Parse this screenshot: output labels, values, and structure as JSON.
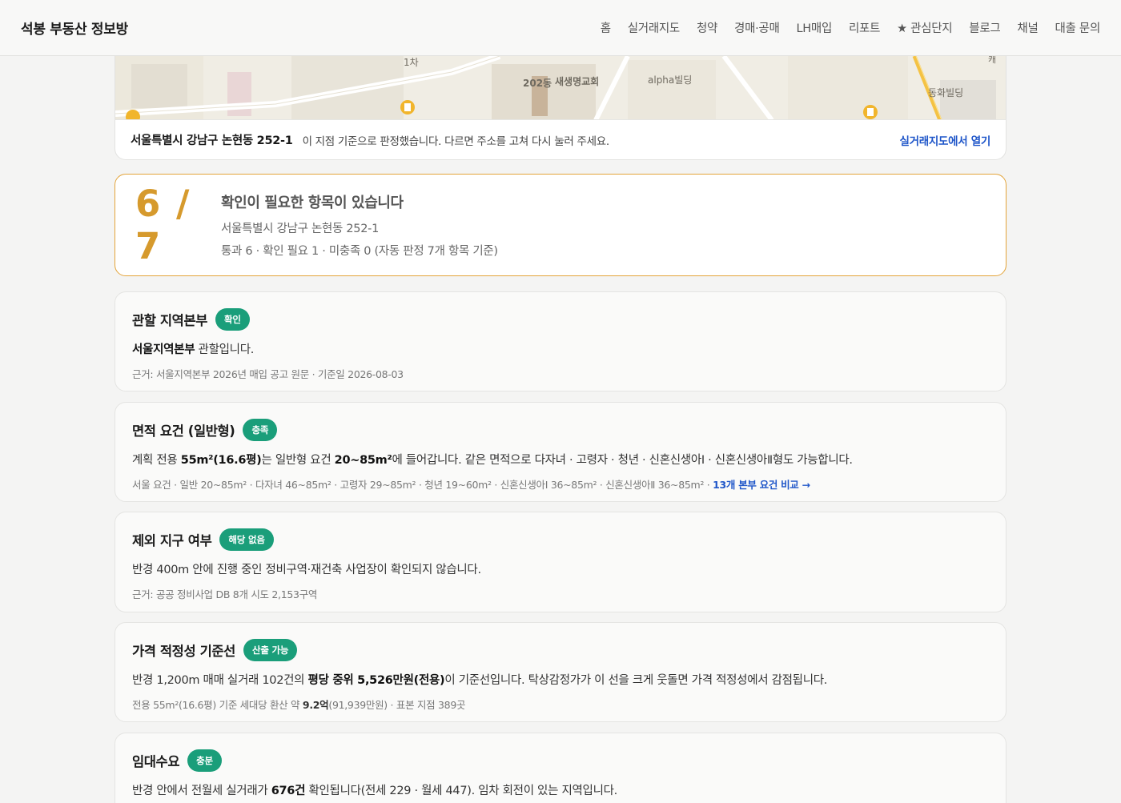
{
  "header": {
    "brand": "석봉 부동산 정보방",
    "nav": [
      "홈",
      "실거래지도",
      "청약",
      "경매·공매",
      "LH매입",
      "리포트",
      "★ 관심단지",
      "블로그",
      "채널",
      "대출 문의"
    ]
  },
  "map": {
    "labels": [
      "1차",
      "202동",
      "새생명교회",
      "alpha빌딩",
      "동화빌딩",
      "캐"
    ]
  },
  "address": {
    "main": "서울특별시 강남구 논현동 252-1",
    "note": "이 지점 기준으로 판정했습니다. 다르면 주소를 고쳐 다시 눌러 주세요.",
    "link": "실거래지도에서 열기"
  },
  "score": {
    "value": "6 / 7",
    "title": "확인이 필요한 항목이 있습니다",
    "address": "서울특별시 강남구 논현동 252-1",
    "summary": "통과 6 · 확인 필요 1 · 미충족 0 (자동 판정 7개 항목 기준)"
  },
  "items": [
    {
      "title": "관할 지역본부",
      "badge": "확인",
      "body_bold": "서울지역본부",
      "body_rest": " 관할입니다.",
      "foot": "근거: 서울지역본부 2026년 매입 공고 원문 · 기준일 2026-08-03"
    },
    {
      "title": "면적 요건 (일반형)",
      "badge": "충족",
      "body_1": "계획 전용 ",
      "body_b1": "55m²(16.6평)",
      "body_2": "는 일반형 요건 ",
      "body_b2": "20~85m²",
      "body_3": "에 들어갑니다. 같은 면적으로 다자녀 · 고령자 · 청년 · 신혼신생아Ⅰ · 신혼신생아Ⅱ형도 가능합니다.",
      "foot": "서울 요건 · 일반 20~85m² · 다자녀 46~85m² · 고령자 29~85m² · 청년 19~60m² · 신혼신생아Ⅰ 36~85m² · 신혼신생아Ⅱ 36~85m² · ",
      "foot_link": "13개 본부 요건 비교 →"
    },
    {
      "title": "제외 지구 여부",
      "badge": "해당 없음",
      "body": "반경 400m 안에 진행 중인 정비구역·재건축 사업장이 확인되지 않습니다.",
      "foot": "근거: 공공 정비사업 DB 8개 시도 2,153구역"
    },
    {
      "title": "가격 적정성 기준선",
      "badge": "산출 가능",
      "body_1": "반경 1,200m 매매 실거래 102건의 ",
      "body_b1": "평당 중위 5,526만원(전용)",
      "body_2": "이 기준선입니다. 탁상감정가가 이 선을 크게 웃돌면 가격 적정성에서 감점됩니다.",
      "foot_1": "전용 55m²(16.6평) 기준 세대당 환산 약 ",
      "foot_b": "9.2억",
      "foot_2": "(91,939만원) · 표본 지점 389곳"
    },
    {
      "title": "임대수요",
      "badge": "충분",
      "body_1": "반경 안에서 전월세 실거래가 ",
      "body_b1": "676건",
      "body_2": " 확인됩니다(전세 229 · 월세 447). 임차 회전이 있는 지역입니다."
    }
  ]
}
